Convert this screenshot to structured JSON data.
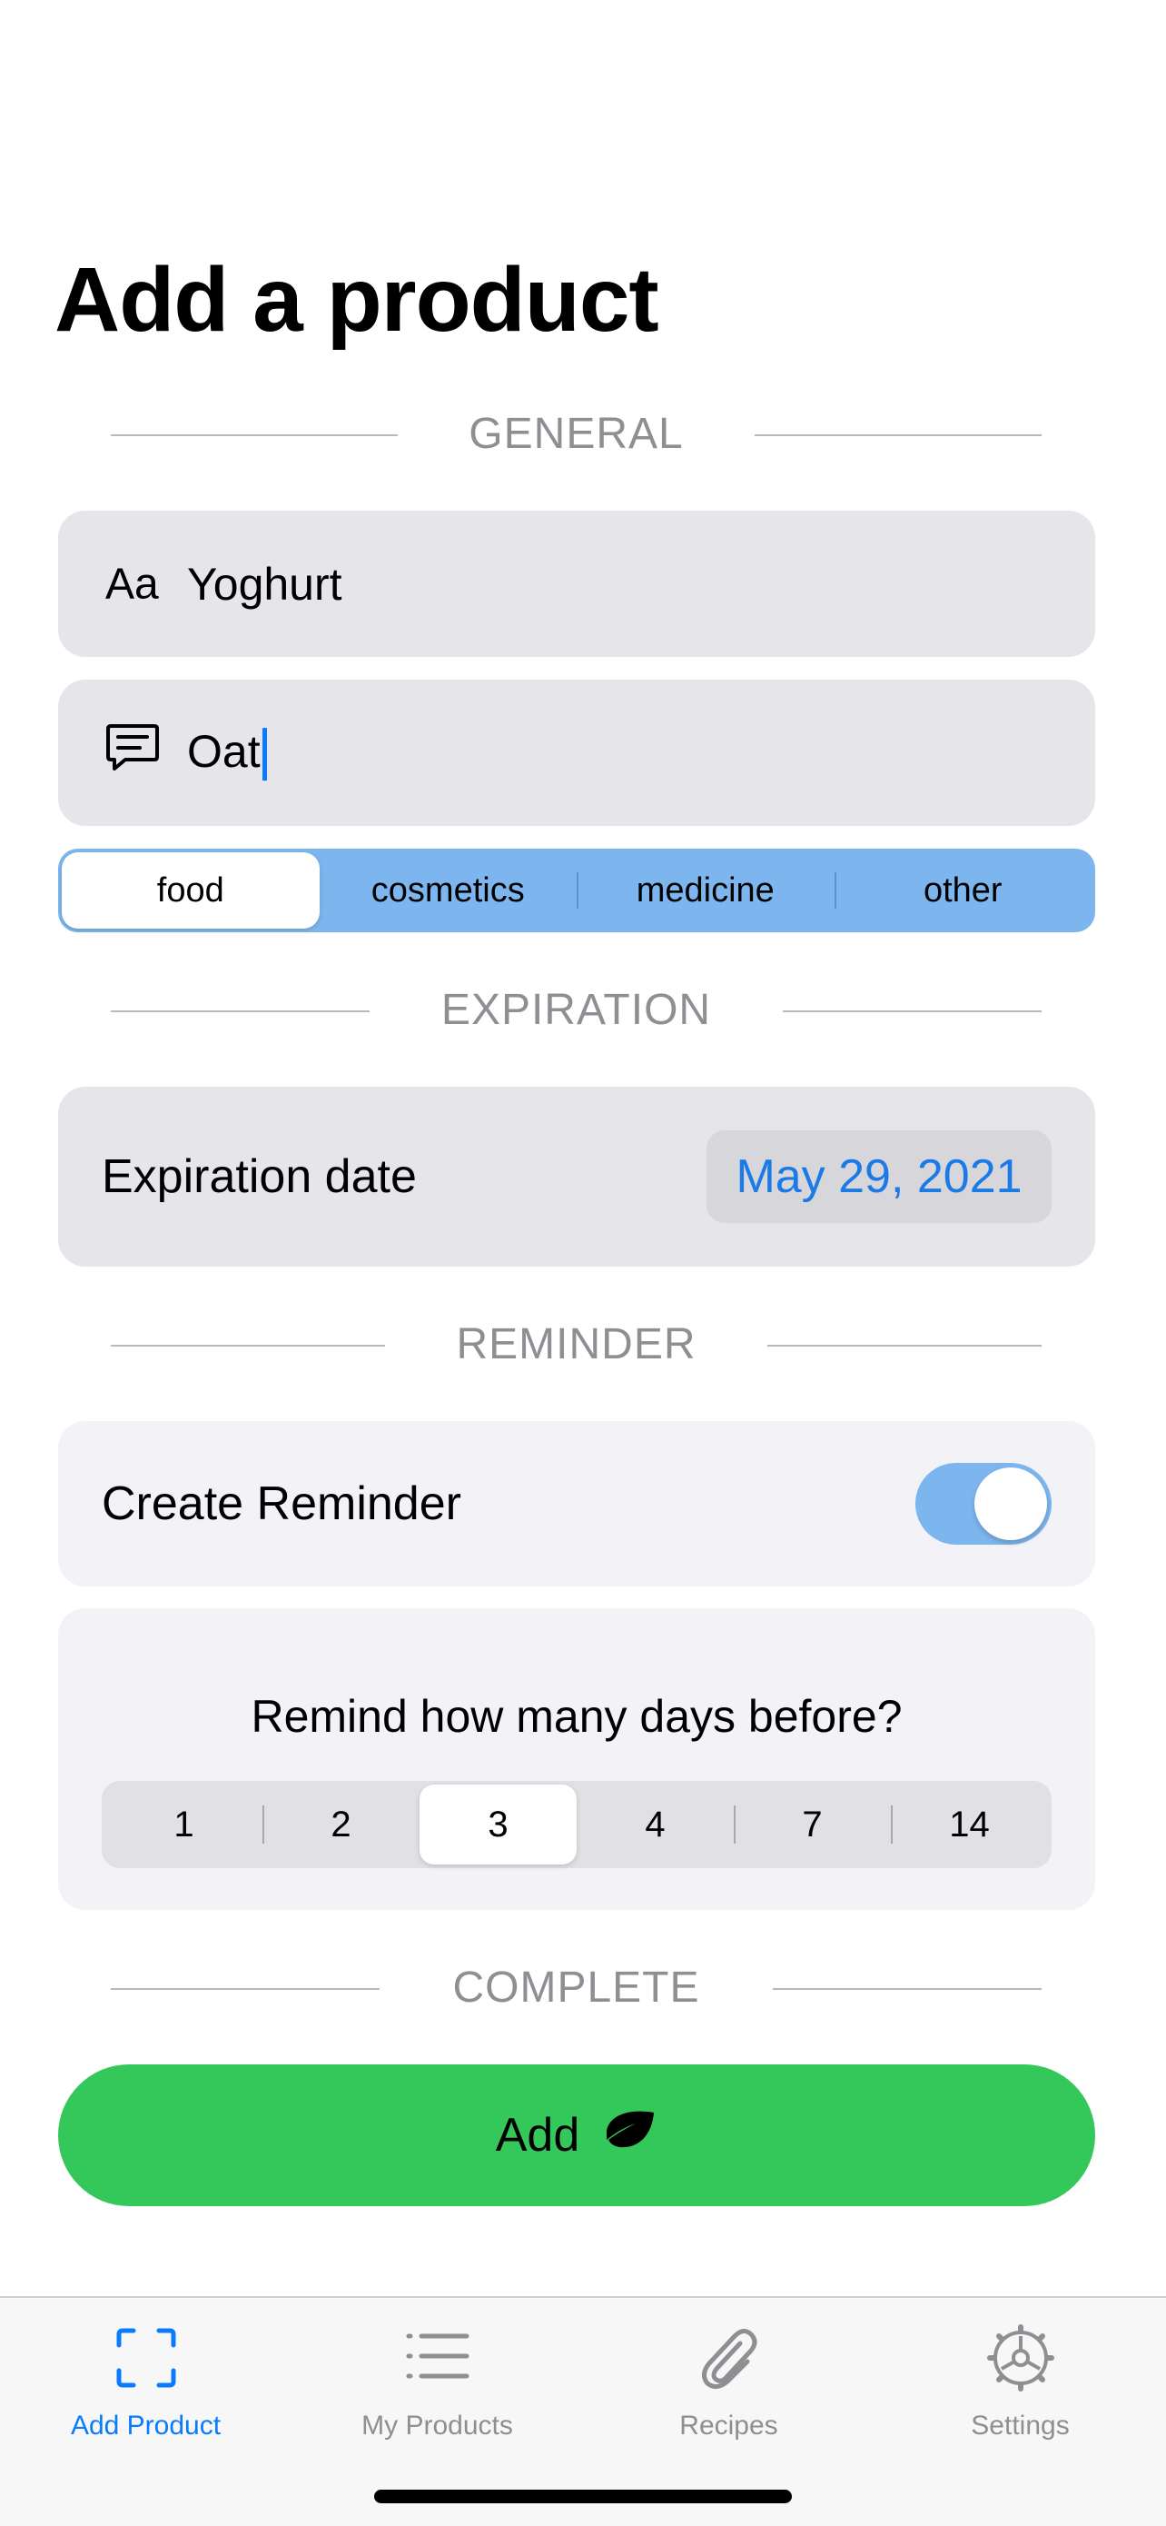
{
  "page": {
    "title": "Add a product"
  },
  "sections": {
    "general": "GENERAL",
    "expiration": "EXPIRATION",
    "reminder": "REMINDER",
    "complete": "COMPLETE"
  },
  "name_field": {
    "icon_text": "Aa",
    "value": "Yoghurt"
  },
  "note_field": {
    "icon": "message-icon",
    "value": "Oat"
  },
  "category": {
    "options": [
      "food",
      "cosmetics",
      "medicine",
      "other"
    ],
    "selected": "food"
  },
  "expiration": {
    "label": "Expiration date",
    "date": "May 29, 2021"
  },
  "reminder": {
    "label": "Create Reminder",
    "enabled": true
  },
  "remind_days": {
    "question": "Remind how many days before?",
    "options": [
      "1",
      "2",
      "3",
      "4",
      "7",
      "14"
    ],
    "selected": "3"
  },
  "add_button": {
    "label": "Add",
    "icon": "leaf-icon"
  },
  "tabbar": {
    "items": [
      {
        "label": "Add Product",
        "icon": "scan-icon",
        "active": true
      },
      {
        "label": "My Products",
        "icon": "list-icon",
        "active": false
      },
      {
        "label": "Recipes",
        "icon": "paperclip-icon",
        "active": false
      },
      {
        "label": "Settings",
        "icon": "gear-icon",
        "active": false
      }
    ]
  },
  "colors": {
    "accent": "#0a7aff",
    "add_button": "#34c85a",
    "segment_bg": "#7db6ee",
    "field_bg": "#e5e5ea",
    "date_text": "#1a7ae6"
  }
}
